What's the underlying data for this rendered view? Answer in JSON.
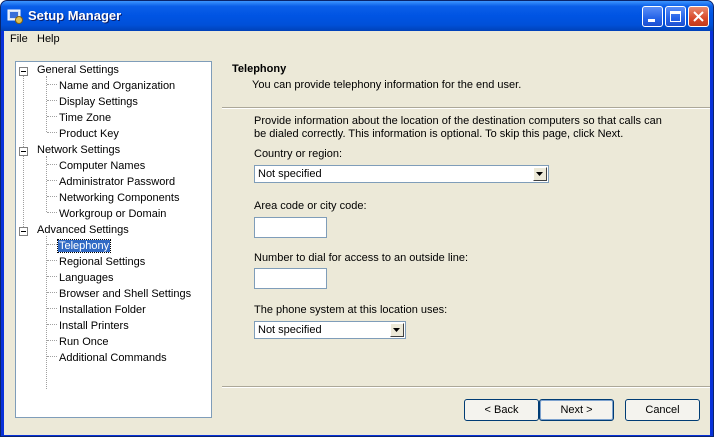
{
  "window": {
    "title": "Setup Manager",
    "icon": "setup-manager-icon"
  },
  "menu": {
    "file": "File",
    "help": "Help"
  },
  "tree": {
    "groups": [
      {
        "label": "General Settings",
        "items": [
          "Name and Organization",
          "Display Settings",
          "Time Zone",
          "Product Key"
        ]
      },
      {
        "label": "Network Settings",
        "items": [
          "Computer Names",
          "Administrator Password",
          "Networking Components",
          "Workgroup or Domain"
        ]
      },
      {
        "label": "Advanced Settings",
        "items": [
          "Telephony",
          "Regional Settings",
          "Languages",
          "Browser and Shell Settings",
          "Installation Folder",
          "Install Printers",
          "Run Once",
          "Additional Commands"
        ]
      }
    ],
    "selected": "Telephony"
  },
  "page": {
    "title": "Telephony",
    "subtitle": "You can provide telephony information for the end user.",
    "intro": "Provide information about the location of the destination computers so that calls can be dialed correctly. This information is optional. To skip this page, click Next.",
    "country_label": "Country or region:",
    "country_value": "Not specified",
    "area_code_label": "Area code or city code:",
    "area_code_value": "",
    "outside_line_label": "Number to dial for access to an outside line:",
    "outside_line_value": "",
    "phone_system_label": "The phone system at this location uses:",
    "phone_system_value": "Not specified"
  },
  "buttons": {
    "back": "< Back",
    "next": "Next >",
    "cancel": "Cancel"
  }
}
